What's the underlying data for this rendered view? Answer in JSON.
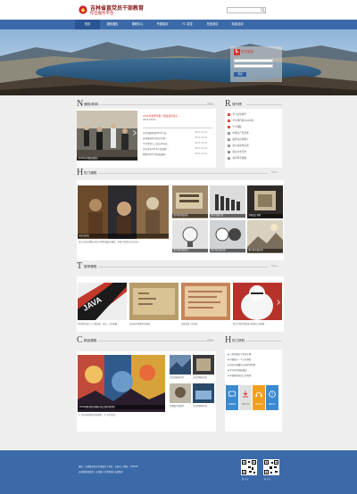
{
  "header": {
    "logo_text": "吉林省直党员干部教育",
    "subtitle": "综合服务平台",
    "search_placeholder": ""
  },
  "nav": {
    "items": [
      "首页",
      "通知通告",
      "课程中心",
      "专题培训",
      "FC 讲堂",
      "在线测试",
      "精品活动"
    ]
  },
  "login": {
    "badge": "L",
    "title": "学员登录",
    "button": "登录"
  },
  "news": {
    "letter": "N",
    "title": "通知/新闻",
    "more": "more",
    "headline": "2015年秋季学期（党政领导班子...",
    "headline_date": "2015-09-01",
    "rows": [
      {
        "text": "关于组织开展2015年度...",
        "date": "2015-09-01"
      },
      {
        "text": "吉林省直机关党员干部...",
        "date": "2015-09-01"
      },
      {
        "text": "学习贯彻十八届五中全会...",
        "date": "2015-09-01"
      },
      {
        "text": "关于发布2015年度课程...",
        "date": "2015-09-01"
      },
      {
        "text": "网络学院平台升级通知...",
        "date": "2015-09-01"
      }
    ],
    "image_caption": "2015年中期培训情况"
  },
  "ranking": {
    "letter": "R",
    "title": "排行榜",
    "items": [
      "学习之星排行",
      "学分排行榜(2015年)",
      "十大课程",
      "中国共产党党史",
      "政务信息化简介",
      "办公自动化应用",
      "机关公文写作",
      "领导科学基础"
    ]
  },
  "hot_courses": {
    "letter": "H",
    "title": "热门课程",
    "more": "more",
    "main_caption": "西方文化史",
    "main_desc": "西方文化史课程以西方文明的发展为线索，系统介绍西方历史文化...",
    "tiles": [
      {
        "caption": "数字图书馆应用"
      },
      {
        "caption": "数字出版产业"
      },
      {
        "caption": "外观设计创新"
      },
      {
        "caption": "数字图书馆应用"
      },
      {
        "caption": "数字图书馆应用"
      },
      {
        "caption": "数字图书馆应用"
      }
    ]
  },
  "recommended": {
    "letter": "T",
    "title": "推荐课程",
    "more": "more",
    "items": [
      {
        "caption": "JAVA程序设计入门到高级：语法，让你掌握..."
      },
      {
        "caption": "宋史研究课程系列讲座"
      },
      {
        "caption": "全国优秀工作总结"
      },
      {
        "caption": "新文学现代化推进与新观点 更新版"
      }
    ]
  },
  "featured": {
    "letter": "C",
    "title": "精品课程",
    "more": "more",
    "main_caption": "2015年图书馆活动研讨会之图书馆资讯",
    "main_desc": "1. 中外美术精彩赏析课程... 2. 名作欣赏...",
    "small": [
      {
        "caption": "走进经典图书馆"
      },
      {
        "caption": "走进经典图书馆"
      },
      {
        "caption": "经典图书馆推荐"
      },
      {
        "caption": "走进经典图书馆"
      }
    ]
  },
  "hot_materials": {
    "letter": "H",
    "title": "热门资料",
    "items": [
      "入党积极分子培训大纲",
      "中国第十一个五年规划",
      "党员干部廉洁从政若干准则",
      "学习型党组织建设",
      "干部教育培训工作条例"
    ],
    "tiles": [
      "在线咨询",
      "资料下载",
      "学习工具",
      "帮助中心"
    ]
  },
  "footer": {
    "line1": "版权：吉林省直机关干部教育 | 地址：长春市 | 邮编：130000",
    "line2": "吉林省委组织部 | 吉林省人力资源和社会保障厅",
    "qr_caption_1": "扫一扫",
    "qr_caption_2": "扫一扫"
  },
  "colors": {
    "nav": "#3c6aa8",
    "accent": "#d9342b",
    "footer": "#3c6aa8"
  }
}
